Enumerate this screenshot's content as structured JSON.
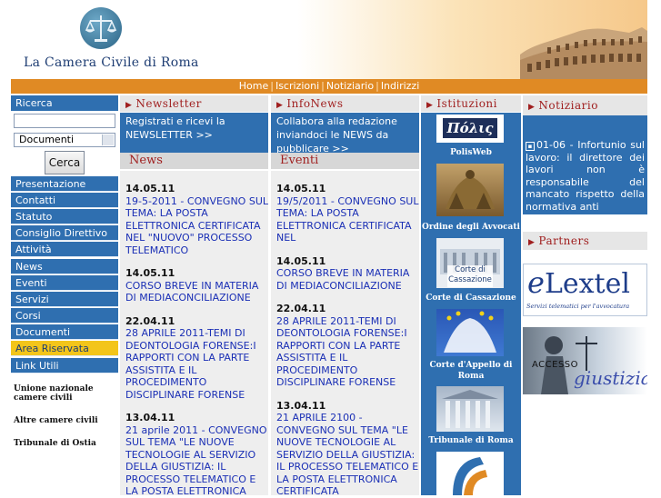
{
  "header": {
    "site_title": "La Camera Civile di Roma"
  },
  "topnav": {
    "items": [
      "Home",
      "Iscrizioni",
      "Notiziario",
      "Indirizzi"
    ]
  },
  "sidebar": {
    "search_label": "Ricerca",
    "search_input_value": "",
    "search_select_value": "Documenti",
    "search_button": "Cerca",
    "items": [
      "Presentazione",
      "Contatti",
      "Statuto",
      "Consiglio Direttivo",
      "Attività",
      "News",
      "Eventi",
      "Servizi",
      "Corsi",
      "Documenti",
      "Area Riservata",
      "Link Utili"
    ],
    "bold_links": [
      "Unione nazionale camere civili",
      "Altre camere civili",
      "Tribunale di Ostia"
    ]
  },
  "newsletter": {
    "title": "Newsletter",
    "text": "Registrati e ricevi la NEWSLETTER >>"
  },
  "infonews": {
    "title": "InfoNews",
    "text": "Collabora alla redazione inviandoci le NEWS da pubblicare >>"
  },
  "istituzioni": {
    "title": "Istituzioni",
    "items": [
      "PolisWeb",
      "Ordine degli Avvocati",
      "Corte di Cassazione",
      "Corte d'Appello di Roma",
      "Tribunale di Roma"
    ],
    "polis_logo": "Πόλις",
    "cassazione_logo": "Corte di Cassazione"
  },
  "news": {
    "title": "News",
    "items": [
      {
        "date": "14.05.11",
        "text": "19-5-2011 - CONVEGNO SUL TEMA: LA POSTA ELETTRONICA CERTIFICATA NEL \"NUOVO\" PROCESSO TELEMATICO"
      },
      {
        "date": "14.05.11",
        "text": "CORSO BREVE IN MATERIA DI MEDIACONCILIAZIONE"
      },
      {
        "date": "22.04.11",
        "text": "28 APRILE 2011-TEMI DI DEONTOLOGIA FORENSE:I RAPPORTI CON LA PARTE ASSISTITA E IL PROCEDIMENTO DISCIPLINARE FORENSE"
      },
      {
        "date": "13.04.11",
        "text": "21 aprile 2011 - CONVEGNO SUL TEMA \"LE NUOVE TECNOLOGIE AL SERVIZIO DELLA GIUSTIZIA: IL PROCESSO TELEMATICO E LA POSTA ELETTRONICA"
      }
    ]
  },
  "eventi": {
    "title": "Eventi",
    "items": [
      {
        "date": "14.05.11",
        "text": "19/5/2011 - CONVEGNO SUL TEMA: LA POSTA ELETTRONICA CERTIFICATA NEL"
      },
      {
        "date": "14.05.11",
        "text": "CORSO BREVE IN MATERIA DI MEDIACONCILIAZIONE"
      },
      {
        "date": "22.04.11",
        "text": "28 APRILE 2011-TEMI DI DEONTOLOGIA FORENSE:I RAPPORTI CON LA PARTE ASSISTITA E IL PROCEDIMENTO DISCIPLINARE FORENSE"
      },
      {
        "date": "13.04.11",
        "text": "21 APRILE 2100 - CONVEGNO SUL TEMA \"LE NUOVE TECNOLOGIE AL SERVIZIO DELLA GIUSTIZIA: IL PROCESSO TELEMATICO E LA POSTA ELETTRONICA CERTIFICATA"
      }
    ]
  },
  "notiziario": {
    "title": "Notiziario",
    "text": "01-06 - Infortunio sul lavoro: il direttore dei lavori non è responsabile del mancato rispetto della normativa anti"
  },
  "partners": {
    "title": "Partners",
    "lextel_name": "Lextel",
    "lextel_tagline": "Servizi telematici per l'avvocatura",
    "accesso_text": "ACCESSO",
    "giustizia_text": "giustizia"
  },
  "colors": {
    "nav_orange": "#e08a24",
    "menu_blue": "#2f6fb0",
    "title_red": "#a01f1f",
    "reserved_yellow": "#f3c51a",
    "link_blue": "#1a2fb5"
  }
}
